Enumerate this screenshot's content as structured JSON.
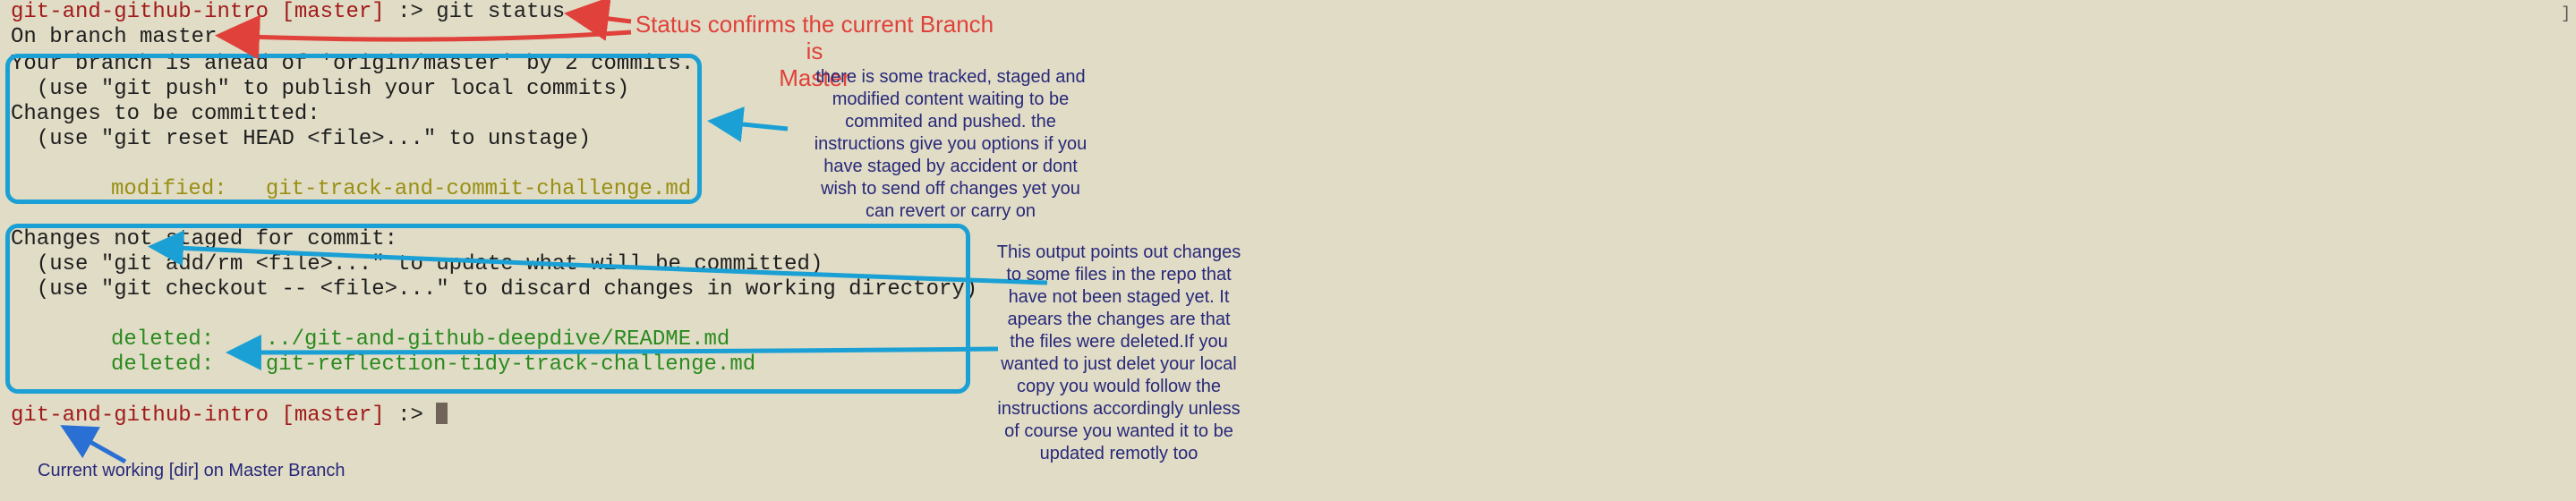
{
  "terminal": {
    "prompt1": {
      "dir": "git-and-github-intro",
      "branch": "[master]",
      "cmd": " :> git status"
    },
    "on_branch": "On branch master",
    "ahead": "Your branch is ahead of 'origin/master' by 2 commits.",
    "push_hint": "  (use \"git push\" to publish your local commits)",
    "to_commit": "Changes to be committed:",
    "reset_hint": "  (use \"git reset HEAD <file>...\" to unstage)",
    "staged_status": "modified:",
    "staged_file": "git-track-and-commit-challenge.md",
    "not_staged": "Changes not staged for commit:",
    "add_hint": "  (use \"git add/rm <file>...\" to update what will be committed)",
    "checkout_hint": "  (use \"git checkout -- <file>...\" to discard changes in working directory)",
    "deleted1_status": "deleted:",
    "deleted1_file": "../git-and-github-deepdive/README.md",
    "deleted2_status": "deleted:",
    "deleted2_file": "git-reflection-tidy-track-challenge.md",
    "prompt2": {
      "dir": "git-and-github-intro",
      "branch": "[master]",
      "cmd": " :> "
    }
  },
  "annotations": {
    "status_note": "Status confirms the current Branch is\nMaster",
    "staged_note": "there is some tracked, staged and\nmodified content waiting to be\ncommited and pushed. the\ninstructions give you options if you\nhave staged by accident or dont\nwish to send off changes yet you\ncan revert or carry on",
    "unstaged_note": "This output points out changes\nto some files in the repo that\nhave not been staged yet. It\napears the changes are that\nthe files were deleted.If you\nwanted to just delet your local\ncopy you would follow the\ninstructions accordingly unless\nof course you wanted it to be\nupdated remotly too",
    "dir_note": "Current working [dir] on Master Branch"
  },
  "scrollbar_mark": "]",
  "colors": {
    "background": "#e0dcc6",
    "box": "#1aa0d4",
    "red_arrow": "#e0413a",
    "blue_text": "#28287a",
    "prompt": "#a11a1a",
    "staged": "#9a8f12",
    "deleted": "#2a8a1e"
  }
}
